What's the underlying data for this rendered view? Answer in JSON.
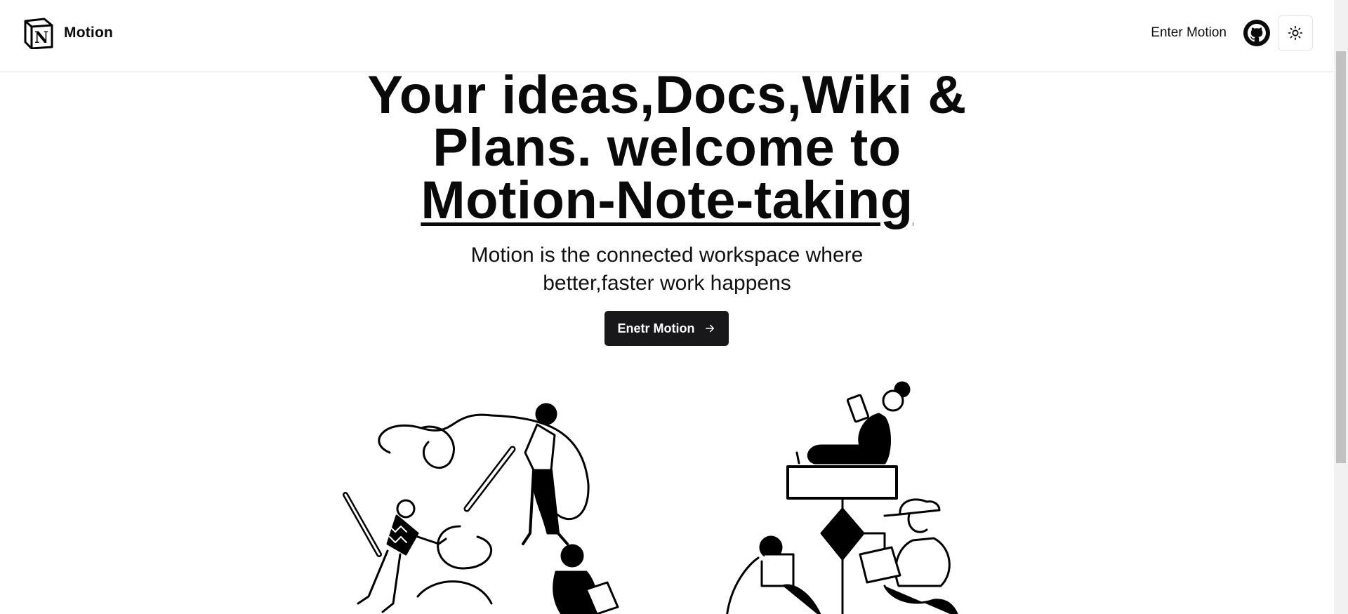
{
  "header": {
    "brand_name": "Motion",
    "brand_logo_letter": "N",
    "enter_link": "Enter Motion",
    "github_icon": "github-icon",
    "theme_icon": "sun-icon"
  },
  "hero": {
    "title_line1": "Your ideas,Docs,Wiki &",
    "title_line2": "Plans. welcome to",
    "title_highlight": "Motion-Note-taking",
    "subtitle_line1": "Motion is the connected workspace where",
    "subtitle_line2": "better,faster work happens",
    "cta_label": "Enetr Motion",
    "cta_icon": "arrow-right-icon"
  },
  "colors": {
    "text": "#0a0a0a",
    "button_bg": "#18181b",
    "border": "#e4e4e7",
    "background": "#ffffff"
  }
}
